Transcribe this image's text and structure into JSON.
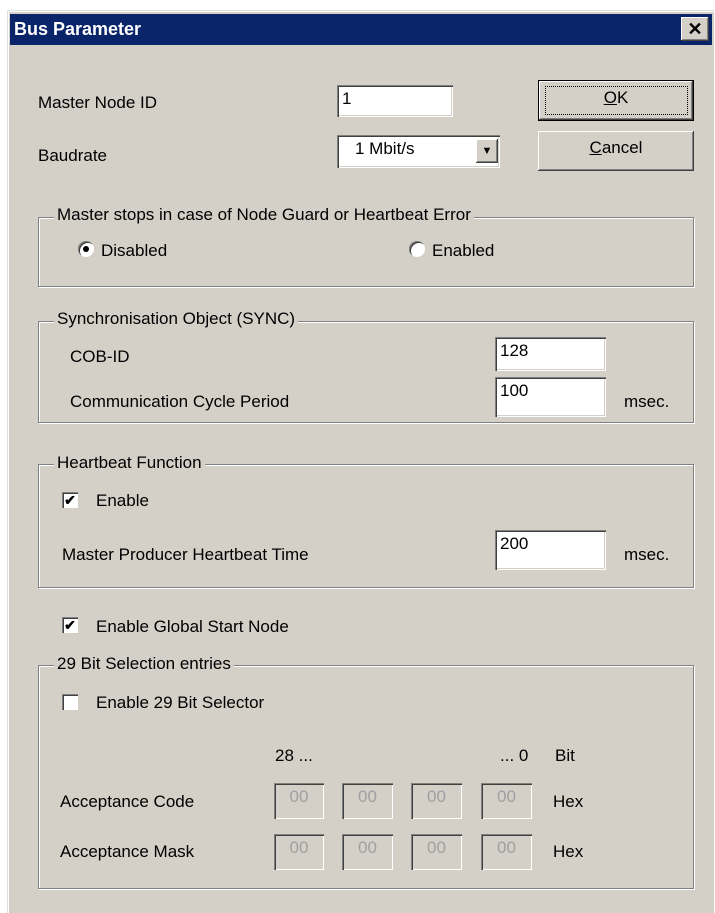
{
  "window": {
    "title": "Bus Parameter",
    "close_glyph": "✕"
  },
  "master_node_id": {
    "label": "Master Node ID",
    "value": "1"
  },
  "baudrate": {
    "label": "Baudrate",
    "value": "1 Mbit/s"
  },
  "buttons": {
    "ok_mnemonic": "O",
    "ok_rest": "K",
    "cancel_mnemonic": "C",
    "cancel_rest": "ancel"
  },
  "guard_error": {
    "group_title": "Master stops in case of Node Guard or Heartbeat Error",
    "options": [
      "Disabled",
      "Enabled"
    ],
    "selected": "Disabled"
  },
  "sync": {
    "group_title": "Synchronisation Object (SYNC)",
    "cob_id_label": "COB-ID",
    "cob_id_value": "128",
    "cycle_label": "Communication Cycle Period",
    "cycle_value": "100",
    "cycle_unit": "msec."
  },
  "heartbeat": {
    "group_title": "Heartbeat Function",
    "enable_label": "Enable",
    "enable_checked": true,
    "time_label": "Master Producer Heartbeat Time",
    "time_value": "200",
    "time_unit": "msec."
  },
  "global_start": {
    "label": "Enable Global Start Node",
    "checked": true
  },
  "bit29": {
    "group_title": "29 Bit Selection entries",
    "enable_label": "Enable 29 Bit Selector",
    "enable_checked": false,
    "range_start": "28 ...",
    "range_end": "... 0",
    "bit_label": "Bit",
    "acceptance_code_label": "Acceptance Code",
    "acceptance_code": [
      "00",
      "00",
      "00",
      "00"
    ],
    "acceptance_mask_label": "Acceptance Mask",
    "acceptance_mask": [
      "00",
      "00",
      "00",
      "00"
    ],
    "hex_label": "Hex"
  },
  "check_glyph": "✔",
  "combo_arrow_glyph": "▼"
}
